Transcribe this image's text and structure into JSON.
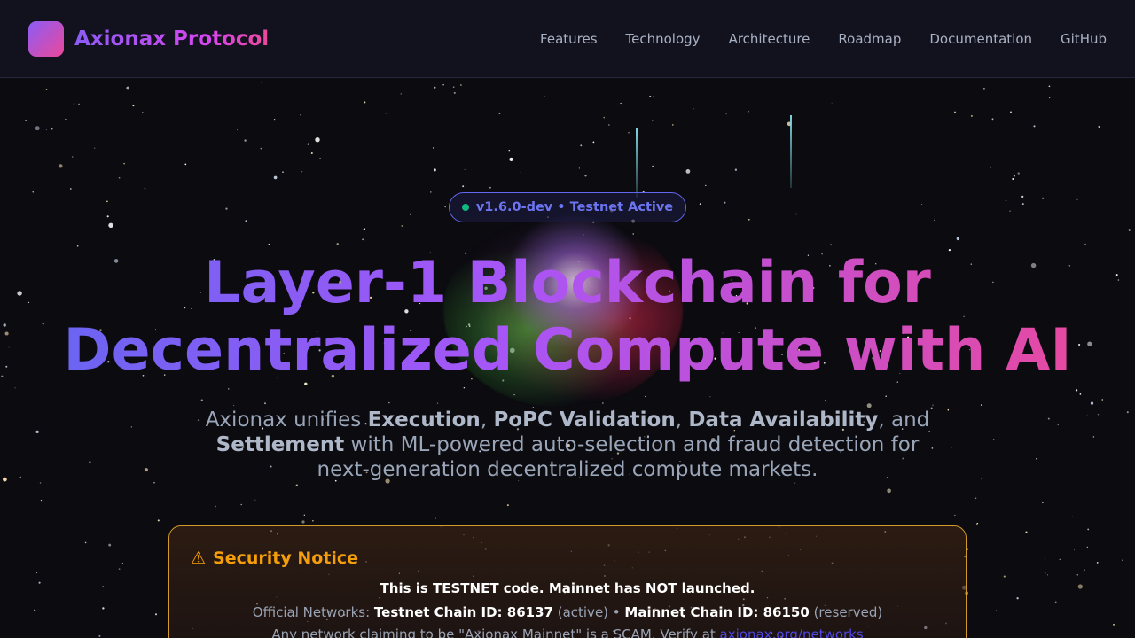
{
  "header": {
    "brand": "Axionax Protocol",
    "nav": [
      "Features",
      "Technology",
      "Architecture",
      "Roadmap",
      "Documentation",
      "GitHub"
    ]
  },
  "hero": {
    "badge": "v1.6.0-dev • Testnet Active",
    "title_line1": "Layer-1 Blockchain for",
    "title_line2": "Decentralized Compute with AI",
    "subtitle": {
      "p1": "Axionax unifies ",
      "b1": "Execution",
      "p2": ", ",
      "b2": "PoPC Validation",
      "p3": ", ",
      "b3": "Data Availability",
      "p4": ", and ",
      "b4": "Settlement",
      "p5": " with ML-powered auto-selection and fraud detection for next-generation decentralized compute markets."
    }
  },
  "notice": {
    "icon": "warning-icon",
    "glyph": "⚠",
    "title": "Security Notice",
    "line1": "This is TESTNET code. Mainnet has NOT launched.",
    "line2_prefix": "Official Networks: ",
    "testnet": "Testnet Chain ID: 86137",
    "testnet_status": " (active) • ",
    "mainnet": "Mainnet Chain ID: 86150",
    "mainnet_status": " (reserved)",
    "line3_prefix": "Any network claiming to be \"Axionax Mainnet\" is a SCAM. Verify at ",
    "link": "axionax.org/networks"
  },
  "colors": {
    "accent_purple": "#8b5cf6",
    "accent_pink": "#ec4899",
    "indigo": "#6366f1",
    "warning": "#f59e0b",
    "status_green": "#10b981"
  }
}
